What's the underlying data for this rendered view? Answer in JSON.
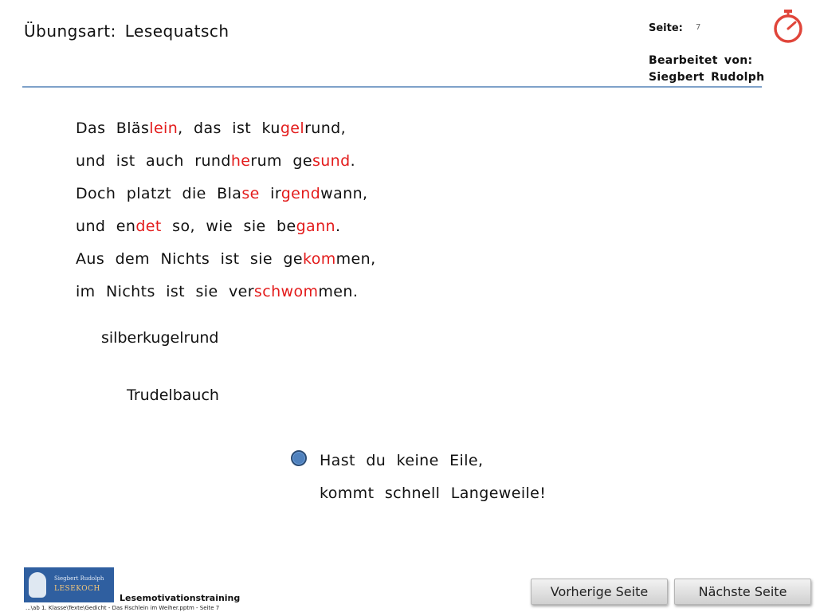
{
  "header": {
    "title": "Übungsart:  Lesequatsch",
    "seite_label": "Seite:",
    "seite_number": "7",
    "edited_by_label": "Bearbeitet von:",
    "edited_by_name": "Siegbert Rudolph"
  },
  "poem": [
    [
      {
        "t": "Das  Bläs",
        "r": false
      },
      {
        "t": "lein",
        "r": true
      },
      {
        "t": ",  das  ist  ku",
        "r": false
      },
      {
        "t": "gel",
        "r": true
      },
      {
        "t": "rund,",
        "r": false
      }
    ],
    [
      {
        "t": "und  ist  auch  rund",
        "r": false
      },
      {
        "t": "he",
        "r": true
      },
      {
        "t": "rum  ge",
        "r": false
      },
      {
        "t": "sund",
        "r": true
      },
      {
        "t": ".",
        "r": false
      }
    ],
    [
      {
        "t": "Doch  platzt  die  Bla",
        "r": false
      },
      {
        "t": "se",
        "r": true
      },
      {
        "t": "  ir",
        "r": false
      },
      {
        "t": "gend",
        "r": true
      },
      {
        "t": "wann,",
        "r": false
      }
    ],
    [
      {
        "t": "und  en",
        "r": false
      },
      {
        "t": "det",
        "r": true
      },
      {
        "t": "  so,  wie  sie  be",
        "r": false
      },
      {
        "t": "gann",
        "r": true
      },
      {
        "t": ".",
        "r": false
      }
    ],
    [
      {
        "t": "Aus  dem  Nichts  ist  sie  ge",
        "r": false
      },
      {
        "t": "kom",
        "r": true
      },
      {
        "t": "men,",
        "r": false
      }
    ],
    [
      {
        "t": "im  Nichts  ist  sie  ver",
        "r": false
      },
      {
        "t": "schwom",
        "r": true
      },
      {
        "t": "men.",
        "r": false
      }
    ]
  ],
  "words": {
    "word1": "silberkugelrund",
    "word2": "Trudelbauch"
  },
  "saying": {
    "line1": "Hast  du  keine  Eile,",
    "line2": "kommt  schnell  Langeweile!"
  },
  "footer": {
    "logo_line1": "Siegbert Rudolph",
    "logo_line2": "LESEKOCH",
    "label": "Lesemotivationstraining",
    "path": "...\\ab 1. Klasse\\Texte\\Gedicht - Das Fischlein im Weiher.pptm - Seite 7"
  },
  "nav": {
    "prev_label": "Vorherige Seite",
    "next_label": "Nächste Seite"
  },
  "colors": {
    "highlight": "#e31b1b",
    "accent_line": "#7ea1c9",
    "timer": "#e0453a",
    "bullet": "#4f81bd"
  },
  "icons": {
    "timer": "stopwatch-icon",
    "bullet": "circle-bullet-icon",
    "logo": "lightbulb-chef-logo"
  }
}
